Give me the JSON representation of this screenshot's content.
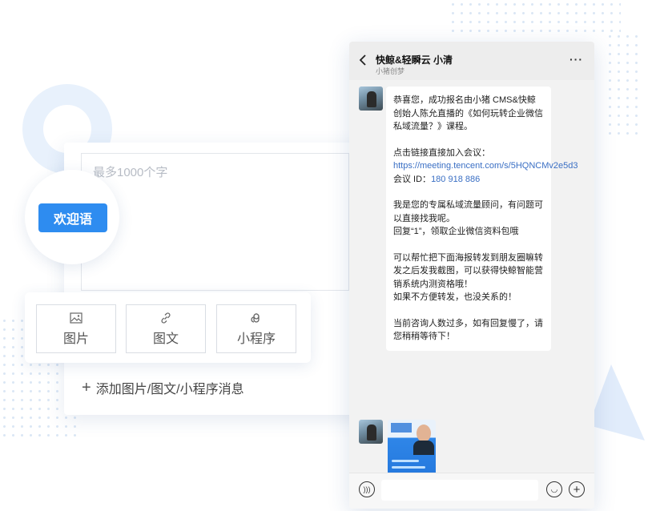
{
  "editor": {
    "placeholder": "最多1000个字",
    "welcome_label": "欢迎语",
    "types": [
      {
        "label": "图片",
        "icon": "image-icon"
      },
      {
        "label": "图文",
        "icon": "link-icon"
      },
      {
        "label": "小程序",
        "icon": "mini-program-icon"
      }
    ],
    "add_message": "添加图片/图文/小程序消息"
  },
  "phone": {
    "title": "快鲸&轻瞬云 小清",
    "subtitle": "小猪创梦",
    "more_label": "···",
    "message": {
      "line1": "恭喜您，成功报名由小猪 CMS&快鲸创始人陈允直播的《如何玩转企业微信私域流量？》课程。",
      "line2": "点击链接直接加入会议：",
      "link": "https://meeting.tencent.com/s/5HQNCMv2e5d3",
      "meeting_label": "会议 ID：",
      "meeting_id": "180 918 886",
      "line3": "我是您的专属私域流量顾问，有问题可以直接找我呢。",
      "line4": "回复“1”，领取企业微信资料包哦",
      "line5": "可以帮忙把下面海报转发到朋友圈嘛转发之后发我截图，可以获得快鲸智能营销系统内测资格哦！",
      "line6": "如果不方便转发，也没关系的！",
      "line7": "当前咨询人数过多，如有回复慢了，请您稍稍等待下！"
    }
  },
  "colors": {
    "accent": "#2e8cf0",
    "link": "#3a6fc4"
  }
}
